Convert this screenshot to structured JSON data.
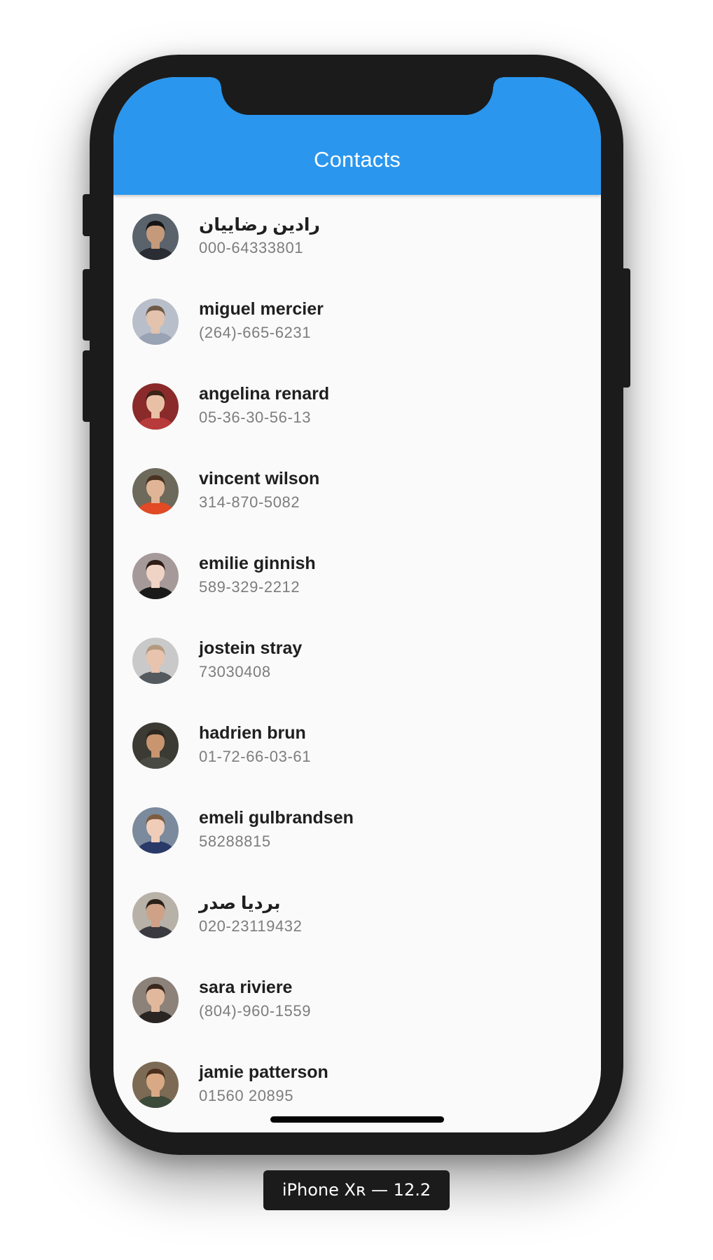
{
  "app": {
    "title": "Contacts",
    "appbar_color": "#2a96ee",
    "background_color": "#fafafa"
  },
  "contacts": [
    {
      "name": "رادين رضاييان",
      "phone": "000-64333801",
      "avatar": {
        "icon": "person-photo",
        "bg": "#5a636b",
        "skin": "#c49a7a",
        "hair": "#151515",
        "shirt": "#2a2d33"
      }
    },
    {
      "name": "miguel mercier",
      "phone": "(264)-665-6231",
      "avatar": {
        "icon": "person-photo",
        "bg": "#b9bfca",
        "skin": "#e3c2ae",
        "hair": "#6f5a48",
        "shirt": "#9aa3b3"
      }
    },
    {
      "name": "angelina renard",
      "phone": "05-36-30-56-13",
      "avatar": {
        "icon": "person-photo",
        "bg": "#8a2a2a",
        "skin": "#e9c0a5",
        "hair": "#3b2316",
        "shirt": "#b83b3b"
      }
    },
    {
      "name": "vincent wilson",
      "phone": "314-870-5082",
      "avatar": {
        "icon": "person-photo",
        "bg": "#6d6a5c",
        "skin": "#e0b597",
        "hair": "#4a3322",
        "shirt": "#e14a24"
      }
    },
    {
      "name": "emilie ginnish",
      "phone": "589-329-2212",
      "avatar": {
        "icon": "person-photo",
        "bg": "#a59a99",
        "skin": "#efd3c4",
        "hair": "#2e1c15",
        "shirt": "#1a1a1a"
      }
    },
    {
      "name": "jostein stray",
      "phone": "73030408",
      "avatar": {
        "icon": "person-photo",
        "bg": "#c9c9c9",
        "skin": "#e8c3ad",
        "hair": "#b39a7f",
        "shirt": "#555a5e"
      }
    },
    {
      "name": "hadrien brun",
      "phone": "01-72-66-03-61",
      "avatar": {
        "icon": "person-photo",
        "bg": "#3b3a33",
        "skin": "#c8956f",
        "hair": "#2b2620",
        "shirt": "#4a4a44"
      }
    },
    {
      "name": "emeli gulbrandsen",
      "phone": "58288815",
      "avatar": {
        "icon": "person-photo",
        "bg": "#7b8a9c",
        "skin": "#efcdb8",
        "hair": "#7e5c3f",
        "shirt": "#2a3a68"
      }
    },
    {
      "name": "برديا صدر",
      "phone": "020-23119432",
      "avatar": {
        "icon": "person-photo",
        "bg": "#b7b1a8",
        "skin": "#cfa186",
        "hair": "#2b2019",
        "shirt": "#3a3a40"
      }
    },
    {
      "name": "sara riviere",
      "phone": "(804)-960-1559",
      "avatar": {
        "icon": "person-photo",
        "bg": "#8c8279",
        "skin": "#e2b89d",
        "hair": "#3a271d",
        "shirt": "#2a2523"
      }
    },
    {
      "name": "jamie patterson",
      "phone": "01560 20895",
      "avatar": {
        "icon": "person-photo",
        "bg": "#7c6a55",
        "skin": "#d9a985",
        "hair": "#4a2f1d",
        "shirt": "#3c4a3a"
      }
    }
  ],
  "device": {
    "label": "iPhone Xʀ — 12.2"
  }
}
